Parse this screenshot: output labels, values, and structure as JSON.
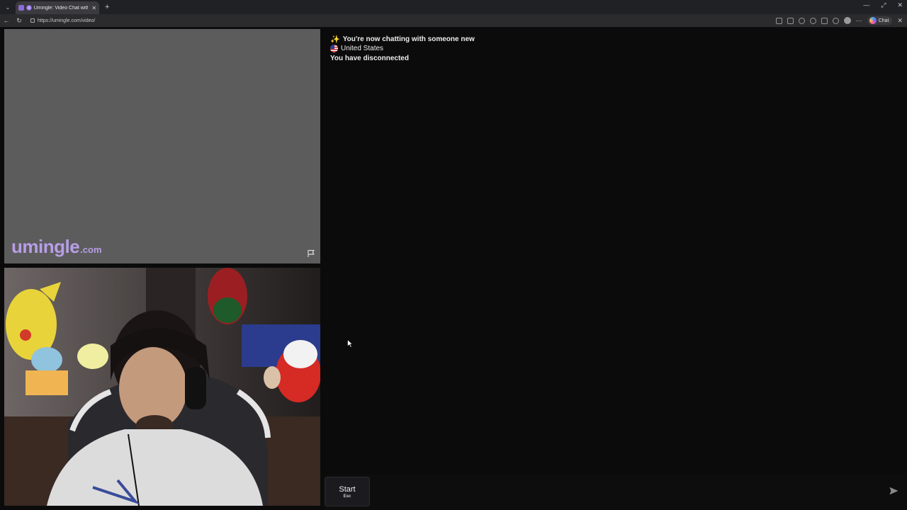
{
  "browser": {
    "tab_title": "Umingle: Video Chat with Strangers",
    "url": "https://umingle.com/video/",
    "copilot_label": "Chat",
    "icons": [
      "tab-list-icon",
      "workspace-icon",
      "favicon",
      "close-icon",
      "plus-icon",
      "minimize-icon",
      "restore-icon",
      "close-window-icon",
      "back-icon",
      "refresh-icon",
      "lock-icon",
      "split-screen-icon",
      "reader-icon",
      "star-icon",
      "sync-icon",
      "extensions-icon",
      "favorites-icon",
      "profile-icon",
      "more-icon",
      "copilot-icon"
    ]
  },
  "stranger_video": {
    "brand_main": "umingle",
    "brand_tld": ".com",
    "brand_color": "#b79ee6",
    "background": "#5c5c5c"
  },
  "chat": {
    "messages": [
      {
        "icon": "sparkle-icon",
        "text": "You're now chatting with someone new"
      },
      {
        "icon": "us-flag-icon",
        "text": "United States"
      },
      {
        "icon": "",
        "text": "You have disconnected"
      }
    ]
  },
  "controls": {
    "start_label": "Start",
    "start_hint": "Esc",
    "input_value": "",
    "send_icon": "send-icon"
  }
}
